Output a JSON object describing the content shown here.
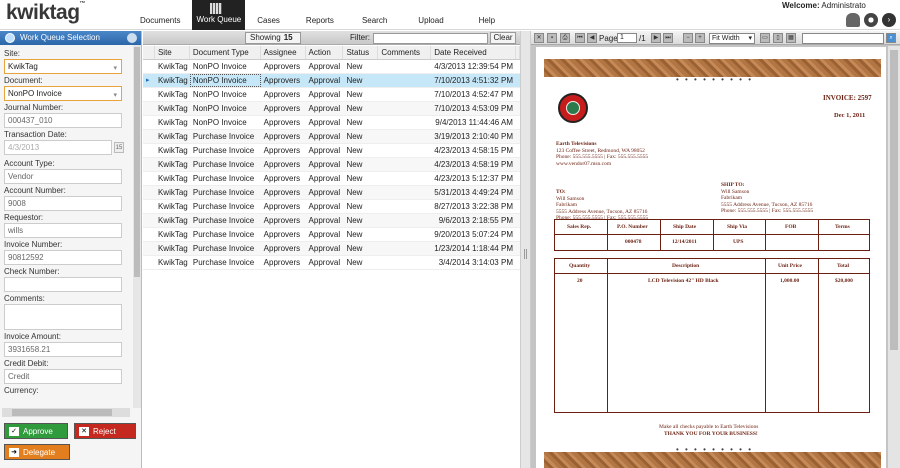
{
  "app": {
    "logo": "kwiktag",
    "tm": "™"
  },
  "nav": [
    "Documents",
    "Work Queue",
    "Cases",
    "Reports",
    "Search",
    "Upload",
    "Help"
  ],
  "welcome": {
    "label": "Welcome:",
    "user": "Administrato"
  },
  "left_panel": {
    "title": "Work Queue Selection",
    "site_label": "Site:",
    "site_value": "KwikTag",
    "document_label": "Document:",
    "document_value": "NonPO Invoice",
    "journal_label": "Journal Number:",
    "journal_value": "000437_010",
    "transaction_label": "Transaction Date:",
    "transaction_value": "4/3/2013",
    "transaction_day": "15",
    "account_type_label": "Account Type:",
    "account_type_value": "Vendor",
    "account_number_label": "Account Number:",
    "account_number_value": "9008",
    "requestor_label": "Requestor:",
    "requestor_value": "wills",
    "invoice_number_label": "Invoice Number:",
    "invoice_number_value": "90812592",
    "check_number_label": "Check Number:",
    "check_number_value": "",
    "comments_label": "Comments:",
    "comments_value": "",
    "invoice_amount_label": "Invoice Amount:",
    "invoice_amount_value": "3931658.21",
    "credit_debit_label": "Credit Debit:",
    "credit_debit_value": "Credit",
    "currency_label": "Currency:",
    "approve_label": "Approve",
    "reject_label": "Reject",
    "delegate_label": "Delegate"
  },
  "queue": {
    "showing_label": "Showing",
    "showing_count": "15",
    "filter_label": "Filter:",
    "clear_label": "Clear",
    "columns": [
      "Site",
      "Document Type",
      "Assignee",
      "Action",
      "Status",
      "Comments",
      "Date Received"
    ],
    "rows": [
      {
        "site": "KwikTag",
        "doc": "NonPO Invoice",
        "assignee": "Approvers",
        "action": "Approval",
        "status": "New",
        "comments": "",
        "date": "4/3/2013 12:39:54 PM"
      },
      {
        "site": "KwikTag",
        "doc": "NonPO Invoice",
        "assignee": "Approvers",
        "action": "Approval",
        "status": "New",
        "comments": "",
        "date": "7/10/2013 4:51:32 PM"
      },
      {
        "site": "KwikTag",
        "doc": "NonPO Invoice",
        "assignee": "Approvers",
        "action": "Approval",
        "status": "New",
        "comments": "",
        "date": "7/10/2013 4:52:47 PM"
      },
      {
        "site": "KwikTag",
        "doc": "NonPO Invoice",
        "assignee": "Approvers",
        "action": "Approval",
        "status": "New",
        "comments": "",
        "date": "7/10/2013 4:53:09 PM"
      },
      {
        "site": "KwikTag",
        "doc": "NonPO Invoice",
        "assignee": "Approvers",
        "action": "Approval",
        "status": "New",
        "comments": "",
        "date": "9/4/2013 11:44:46 AM"
      },
      {
        "site": "KwikTag",
        "doc": "Purchase Invoice",
        "assignee": "Approvers",
        "action": "Approval",
        "status": "New",
        "comments": "",
        "date": "3/19/2013 2:10:40 PM"
      },
      {
        "site": "KwikTag",
        "doc": "Purchase Invoice",
        "assignee": "Approvers",
        "action": "Approval",
        "status": "New",
        "comments": "",
        "date": "4/23/2013 4:58:15 PM"
      },
      {
        "site": "KwikTag",
        "doc": "Purchase Invoice",
        "assignee": "Approvers",
        "action": "Approval",
        "status": "New",
        "comments": "",
        "date": "4/23/2013 4:58:19 PM"
      },
      {
        "site": "KwikTag",
        "doc": "Purchase Invoice",
        "assignee": "Approvers",
        "action": "Approval",
        "status": "New",
        "comments": "",
        "date": "4/23/2013 5:12:37 PM"
      },
      {
        "site": "KwikTag",
        "doc": "Purchase Invoice",
        "assignee": "Approvers",
        "action": "Approval",
        "status": "New",
        "comments": "",
        "date": "5/31/2013 4:49:24 PM"
      },
      {
        "site": "KwikTag",
        "doc": "Purchase Invoice",
        "assignee": "Approvers",
        "action": "Approval",
        "status": "New",
        "comments": "",
        "date": "8/27/2013 3:22:38 PM"
      },
      {
        "site": "KwikTag",
        "doc": "Purchase Invoice",
        "assignee": "Approvers",
        "action": "Approval",
        "status": "New",
        "comments": "",
        "date": "9/6/2013 2:18:55 PM"
      },
      {
        "site": "KwikTag",
        "doc": "Purchase Invoice",
        "assignee": "Approvers",
        "action": "Approval",
        "status": "New",
        "comments": "",
        "date": "9/20/2013 5:07:24 PM"
      },
      {
        "site": "KwikTag",
        "doc": "Purchase Invoice",
        "assignee": "Approvers",
        "action": "Approval",
        "status": "New",
        "comments": "",
        "date": "1/23/2014 1:18:44 PM"
      },
      {
        "site": "KwikTag",
        "doc": "Purchase Invoice",
        "assignee": "Approvers",
        "action": "Approval",
        "status": "New",
        "comments": "",
        "date": "3/4/2014 3:14:03 PM"
      }
    ]
  },
  "viewer": {
    "page_label": "Page",
    "page_value": "1",
    "page_total": "/1",
    "zoom_value": "Fit Width",
    "invoice": {
      "title": "INVOICE: 2597",
      "date": "Dec 1, 2011",
      "company": "Earth Televisions",
      "address": "123 Coffee Street, Redmond, WA 98052",
      "phone": "Phone: 555.555.5555 | Fax: 555.555.5555",
      "web": "www.vendor07.msn.com",
      "to_label": "TO:",
      "to_name": "Will Samson",
      "to_company": "Fabrikam",
      "to_address": "5555 Address Avenue, Tucson, AZ 85716",
      "to_phone": "Phone: 555.555.5555 | Fax: 555.555.5555",
      "ship_label": "SHIP TO:",
      "ship_name": "Will Samson",
      "ship_company": "Fabrikam",
      "ship_address": "5555 Address Avenue, Tucson, AZ 85716",
      "ship_phone": "Phone: 555.555.5555 | Fax: 555.555.5555",
      "ship_headers": [
        "Sales Rep.",
        "P.O. Number",
        "Ship Date",
        "Ship Via",
        "FOB",
        "Terms"
      ],
      "ship_values": [
        "",
        "000478",
        "12/14/2011",
        "UPS",
        "",
        ""
      ],
      "item_headers": [
        "Quantity",
        "Description",
        "Unit Price",
        "Total"
      ],
      "item_values": [
        "20",
        "LCD Television 42\" HD Black",
        "1,000.00",
        "$20,000"
      ],
      "footer1": "Make all checks payable to Earth Televisions",
      "footer2": "THANK YOU FOR YOUR BUSINESS!"
    }
  }
}
